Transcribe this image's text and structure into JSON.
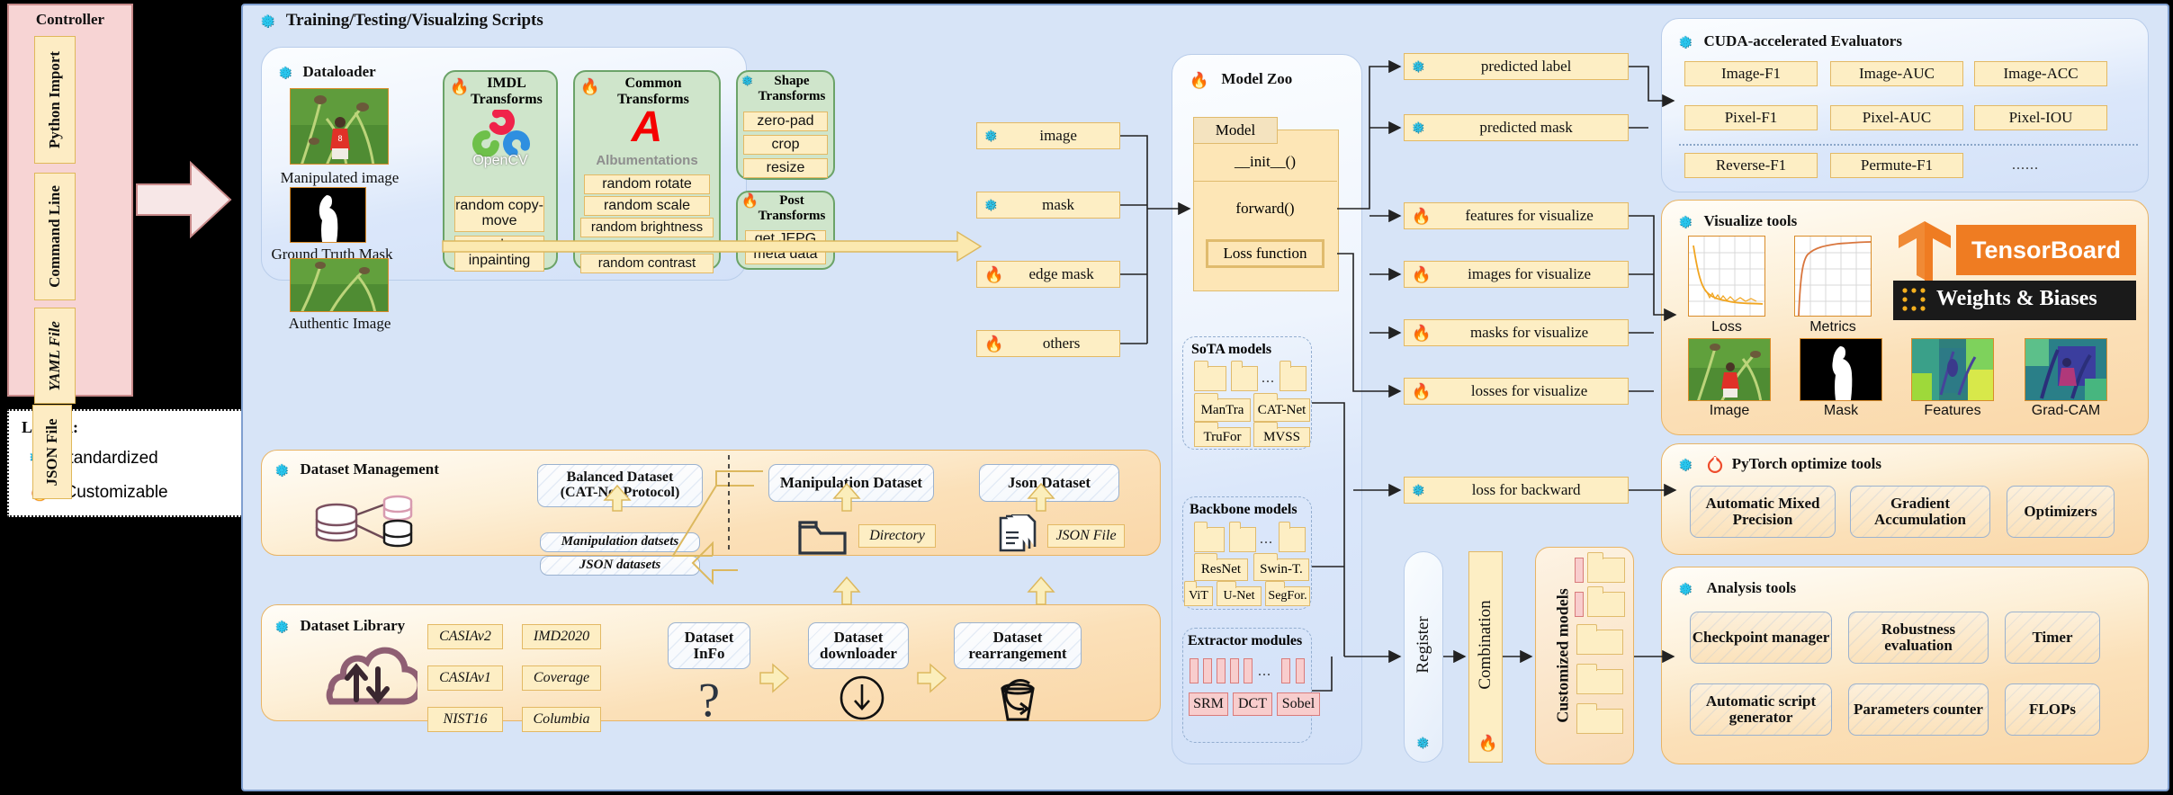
{
  "controller": {
    "title": "Controller",
    "items": [
      "Python Import",
      "Command Line",
      "YAML File",
      "JSON File"
    ]
  },
  "legend": {
    "title": "Legend:",
    "rows": [
      {
        "icon": "snowflake-icon",
        "text": ": Standardized"
      },
      {
        "icon": "fire-icon",
        "text": ": Customizable"
      }
    ]
  },
  "main": {
    "title": "Training/Testing/Visualzing Scripts"
  },
  "dataloader": {
    "title": "Dataloader",
    "thumbs": [
      {
        "caption": "Manipulated image"
      },
      {
        "caption": "Ground Truth Mask"
      },
      {
        "caption": "Authentic Image"
      }
    ],
    "imdl": {
      "title_line1": "IMDL",
      "title_line2": "Transforms",
      "logo": "OpenCV",
      "items": [
        "random copy-move",
        "random inpainting"
      ]
    },
    "common": {
      "title_line1": "Common",
      "title_line2": "Transforms",
      "logo": "Albumentations",
      "items": [
        "random rotate",
        "random scale",
        "random brightness",
        "random contrast"
      ],
      "ellipsis": "......"
    },
    "shape": {
      "title_line1": "Shape",
      "title_line2": "Transforms",
      "items": [
        "zero-pad",
        "crop",
        "resize"
      ]
    },
    "post": {
      "title_line1": "Post",
      "title_line2": "Transforms",
      "items": [
        "get JEPG meta data"
      ]
    }
  },
  "dataloader_outputs": [
    {
      "icon": "snowflake-icon",
      "label": "image"
    },
    {
      "icon": "snowflake-icon",
      "label": "mask"
    },
    {
      "icon": "fire-icon",
      "label": "edge mask"
    },
    {
      "icon": "fire-icon",
      "label": "others"
    }
  ],
  "model_zoo": {
    "title": "Model Zoo",
    "model_class": {
      "header": "Model",
      "init": "__init__()",
      "forward": "forward()",
      "loss": "Loss function"
    },
    "sota": {
      "title": "SoTA models",
      "ellipsis": "...",
      "items": [
        "ManTra",
        "CAT-Net",
        "TruFor",
        "MVSS"
      ]
    },
    "backbone": {
      "title": "Backbone models",
      "ellipsis": "...",
      "items": [
        "ResNet",
        "Swin-T.",
        "ViT",
        "U-Net",
        "SegFor."
      ]
    },
    "extractor": {
      "title": "Extractor modules",
      "ellipsis": "...",
      "items": [
        "SRM",
        "DCT",
        "Sobel"
      ]
    }
  },
  "model_outputs": [
    {
      "icon": "snowflake-icon",
      "label": "predicted label"
    },
    {
      "icon": "snowflake-icon",
      "label": "predicted mask"
    },
    {
      "icon": "fire-icon",
      "label": "features for visualize"
    },
    {
      "icon": "fire-icon",
      "label": "images for visualize"
    },
    {
      "icon": "fire-icon",
      "label": "masks for visualize"
    },
    {
      "icon": "fire-icon",
      "label": "losses for visualize"
    },
    {
      "icon": "snowflake-icon",
      "label": "loss for backward"
    }
  ],
  "register": {
    "label": "Register",
    "icon": "snowflake-icon"
  },
  "combination": {
    "label": "Combination",
    "icon": "fire-icon"
  },
  "customized_models": {
    "label": "Customized models"
  },
  "dataset_management": {
    "title": "Dataset Management",
    "balanced": "Balanced Dataset\n(CAT-Net Protocol)",
    "balanced_line1": "Balanced Dataset",
    "balanced_line2": "(CAT-Net Protocol)",
    "sub_items": [
      "Manipulation datsets",
      "JSON datasets"
    ],
    "manipulation_dataset": "Manipulation Dataset",
    "json_dataset": "Json Dataset",
    "directory": "Directory",
    "json_file": "JSON File"
  },
  "dataset_library": {
    "title": "Dataset Library",
    "datasets": [
      "CASIAv2",
      "IMD2020",
      "CASIAv1",
      "Coverage",
      "NIST16",
      "Columbia"
    ],
    "steps": [
      {
        "line1": "Dataset",
        "line2": "InFo",
        "icon": "question-mark-icon"
      },
      {
        "line1": "Dataset",
        "line2": "downloader",
        "icon": "download-arrow-icon"
      },
      {
        "line1": "Dataset",
        "line2": "rearrangement",
        "icon": "bucket-refresh-icon"
      }
    ]
  },
  "evaluators": {
    "title": "CUDA-accelerated Evaluators",
    "row1": [
      "Image-F1",
      "Image-AUC",
      "Image-ACC"
    ],
    "row2": [
      "Pixel-F1",
      "Pixel-AUC",
      "Pixel-IOU"
    ],
    "row3": [
      "Reverse-F1",
      "Permute-F1"
    ],
    "ellipsis": "......"
  },
  "visualize_tools": {
    "title": "Visualize tools",
    "charts": [
      {
        "caption": "Loss"
      },
      {
        "caption": "Metrics"
      }
    ],
    "thumbs": [
      {
        "caption": "Image"
      },
      {
        "caption": "Mask"
      },
      {
        "caption": "Features"
      },
      {
        "caption": "Grad-CAM"
      }
    ],
    "logos": [
      "TensorBoard",
      "Weights & Biases"
    ]
  },
  "pytorch_tools": {
    "title": "PyTorch optimize tools",
    "items": [
      "Automatic Mixed Precision",
      "Gradient Accumulation",
      "Optimizers"
    ]
  },
  "analysis_tools": {
    "title": "Analysis tools",
    "items": [
      "Checkpoint manager",
      "Robustness evaluation",
      "Timer",
      "Automatic script generator",
      "Parameters counter",
      "FLOPs"
    ]
  },
  "colors": {
    "panel_blue": "#d7e4f7",
    "tile_yellow": "#fdeec4",
    "green": "#cfe5cb",
    "pink": "#f8cdcd",
    "accent_orange": "#e8912a",
    "tensorboard_orange": "#ef7c22",
    "wandb_black": "#1a1a1a"
  }
}
